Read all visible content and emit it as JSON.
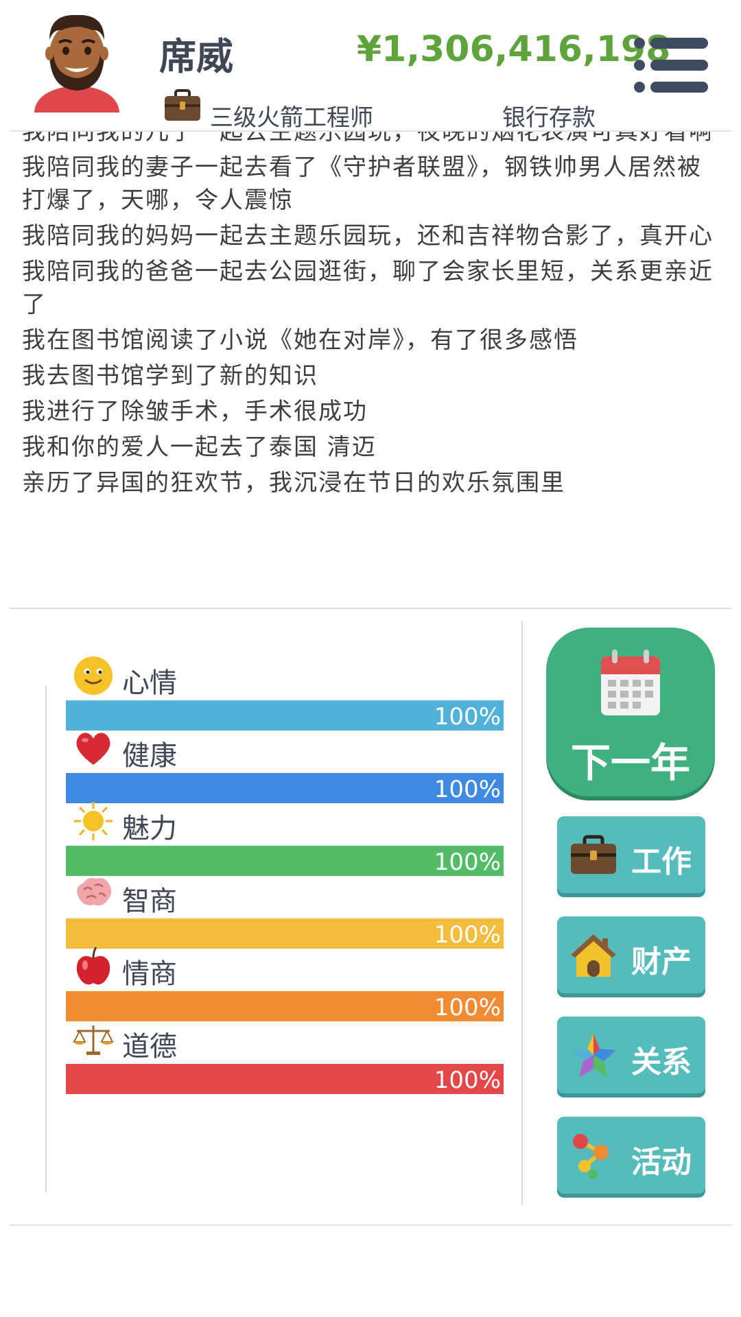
{
  "header": {
    "player_name": "席威",
    "money": "¥1,306,416,198",
    "job_title": "三级火箭工程师",
    "bank_label": "银行存款",
    "avatar_icon": "bearded-man-avatar",
    "job_icon": "briefcase-icon",
    "menu_icon": "menu-list-icon",
    "money_color": "#5fa33d"
  },
  "log": {
    "lines": [
      "我陪同我的儿子一起去主题乐园玩，夜晚的烟花表演可真好看啊",
      "我陪同我的妻子一起去看了《守护者联盟》，钢铁帅男人居然被打爆了，天哪，令人震惊",
      "我陪同我的妈妈一起去主题乐园玩，还和吉祥物合影了，真开心",
      "我陪同我的爸爸一起去公园逛街，聊了会家长里短，关系更亲近了",
      "我在图书馆阅读了小说《她在对岸》，有了很多感悟",
      "我去图书馆学到了新的知识",
      "我进行了除皱手术，手术很成功",
      "我和你的爱人一起去了泰国 清迈",
      "亲历了异国的狂欢节，我沉浸在节日的欢乐氛围里"
    ]
  },
  "stats": [
    {
      "label": "心情",
      "percent_text": "100%",
      "value": 100,
      "color": "#52b1d9",
      "icon": "smiley-face-icon"
    },
    {
      "label": "健康",
      "percent_text": "100%",
      "value": 100,
      "color": "#3f8ae0",
      "icon": "heart-icon"
    },
    {
      "label": "魅力",
      "percent_text": "100%",
      "value": 100,
      "color": "#52bd66",
      "icon": "sun-icon"
    },
    {
      "label": "智商",
      "percent_text": "100%",
      "value": 100,
      "color": "#f2bd3c",
      "icon": "brain-icon"
    },
    {
      "label": "情商",
      "percent_text": "100%",
      "value": 100,
      "color": "#f08a33",
      "icon": "apple-icon"
    },
    {
      "label": "道德",
      "percent_text": "100%",
      "value": 100,
      "color": "#e34747",
      "icon": "scales-icon"
    }
  ],
  "actions": {
    "next_year": {
      "label": "下一年",
      "icon": "calendar-icon",
      "color": "#3fb07f"
    },
    "buttons": [
      {
        "label": "工作",
        "icon": "briefcase-icon"
      },
      {
        "label": "财产",
        "icon": "house-icon"
      },
      {
        "label": "关系",
        "icon": "star-icon"
      },
      {
        "label": "活动",
        "icon": "dots-activity-icon"
      }
    ],
    "button_color": "#56bbbb"
  }
}
